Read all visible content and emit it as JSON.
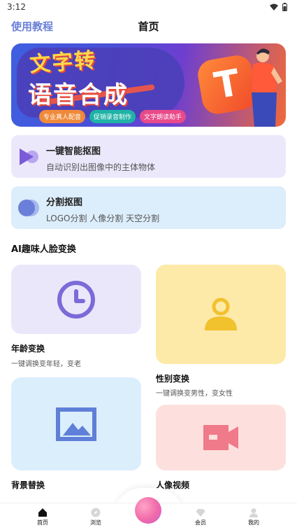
{
  "status_bar": {
    "time": "3:12"
  },
  "nav": {
    "tutorial_label": "使用教程",
    "title": "首页"
  },
  "banner": {
    "line1": "文字转",
    "line2": "语音合成",
    "tags": [
      "专业真人配音",
      "促销录音制作",
      "文字朗读助手"
    ],
    "tag_colors": [
      "#f08a3a",
      "#1fb3a6",
      "#e84a8a"
    ],
    "logo_letter": "T"
  },
  "features": [
    {
      "title": "一键智能抠图",
      "desc": "自动识别出图像中的主体物体",
      "icon": "play-triangle-icon"
    },
    {
      "title": "分割抠图",
      "desc": "LOGO分割 人像分割 天空分割",
      "icon": "overlap-circles-icon"
    }
  ],
  "section": {
    "title": "AI趣味人脸变换"
  },
  "grid": [
    {
      "title": "年龄变换",
      "desc": "一键调换变年轻，变老",
      "icon": "clock-icon"
    },
    {
      "title": "性别变换",
      "desc": "一键调换变男性，变女性",
      "icon": "person-icon"
    },
    {
      "title": "背景替换",
      "icon": "image-icon"
    },
    {
      "title": "人像视频",
      "icon": "video-camera-icon"
    }
  ],
  "tabs": [
    {
      "label": "首页",
      "icon": "home-icon"
    },
    {
      "label": "浏览",
      "icon": "compass-icon"
    },
    {
      "label": "会员",
      "icon": "diamond-icon"
    },
    {
      "label": "我的",
      "icon": "user-icon"
    }
  ],
  "colors": {
    "accent": "#6a7fd8",
    "clock": "#7b6bd8",
    "person": "#f7c93a",
    "image": "#5f7fd8",
    "video": "#f07a8a"
  }
}
